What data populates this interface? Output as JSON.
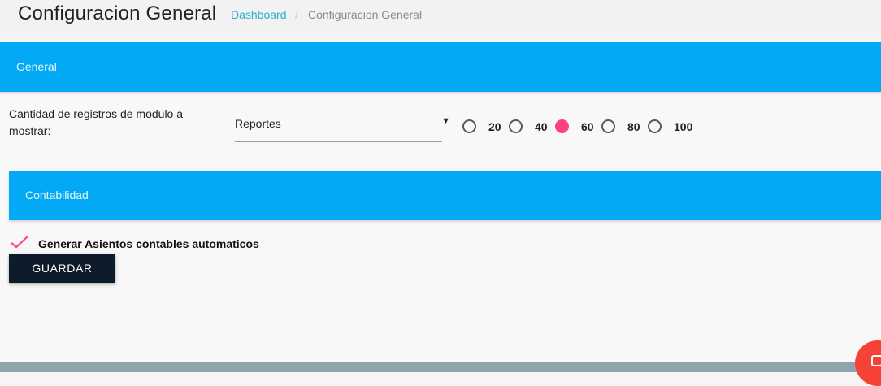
{
  "header": {
    "title": "Configuracion General",
    "breadcrumb": {
      "link": "Dashboard",
      "separator": "/",
      "current": "Configuracion General"
    }
  },
  "general": {
    "section_title": "General",
    "field_label": "Cantidad de registros de modulo a mostrar:",
    "select": {
      "value": "Reportes"
    },
    "radio_options": [
      "20",
      "40",
      "60",
      "80",
      "100"
    ],
    "radio_selected": "40"
  },
  "contabilidad": {
    "section_title": "Contabilidad",
    "checkbox_label": "Generar Asientos contables automaticos",
    "checkbox_checked": true
  },
  "actions": {
    "save_label": "GUARDAR"
  },
  "colors": {
    "accent": "#03a9f4",
    "radio_checked": "#ff4081",
    "button": "#0d1b2a",
    "link": "#26b0c9"
  }
}
